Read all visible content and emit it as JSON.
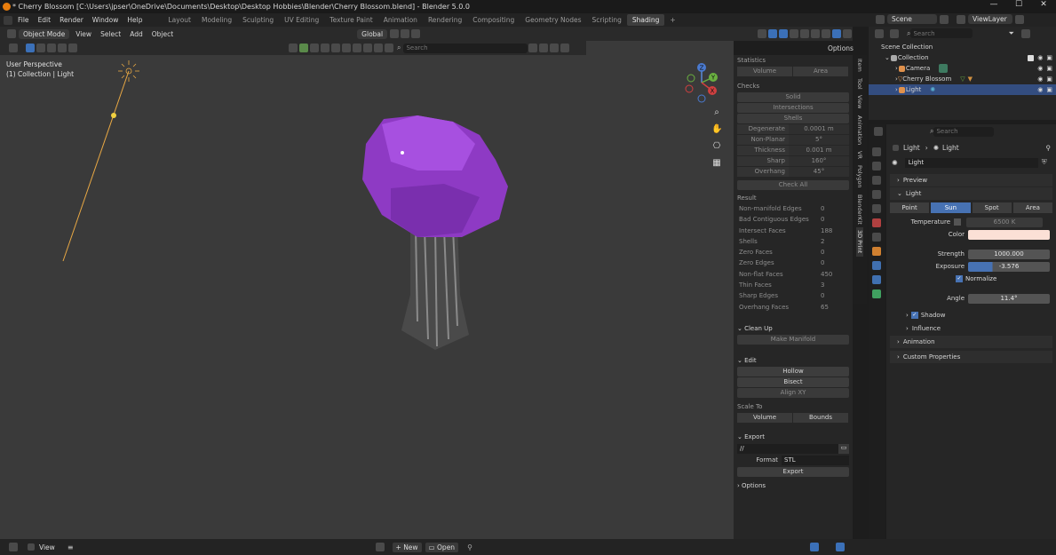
{
  "window": {
    "title": "* Cherry Blossom [C:\\Users\\jpser\\OneDrive\\Documents\\Desktop\\Desktop Hobbies\\Blender\\Cherry Blossom.blend] - Blender 5.0.0"
  },
  "menu": {
    "items": [
      "File",
      "Edit",
      "Render",
      "Window",
      "Help"
    ]
  },
  "workspaces": [
    "Layout",
    "Modeling",
    "Sculpting",
    "UV Editing",
    "Texture Paint",
    "Animation",
    "Rendering",
    "Compositing",
    "Geometry Nodes",
    "Scripting",
    "Shading"
  ],
  "scene": {
    "label": "Scene",
    "viewlayer": "ViewLayer",
    "search_placeholder": "Search"
  },
  "viewport_header": {
    "mode": "Object Mode",
    "view": "View",
    "select": "Select",
    "add": "Add",
    "object": "Object",
    "orientation": "Global",
    "options": "Options",
    "search_placeholder": "Search"
  },
  "viewport": {
    "perspective": "User Perspective",
    "collection": "(1) Collection | Light",
    "colors": {
      "bg": "#3a3a3a",
      "canopy": "#9b3fd0",
      "trunk": "#6a6a6a",
      "light_line": "#e8a844"
    }
  },
  "nav_gizmo": {
    "x": "X",
    "y": "Y",
    "z": "Z"
  },
  "npanel": {
    "statistics": "Statistics",
    "stat_volume": "Volume",
    "stat_area": "Area",
    "checks": "Checks",
    "solid": "Solid",
    "intersections": "Intersections",
    "shells": "Shells",
    "fields": [
      {
        "l": "Degenerate",
        "v": "0.0001 m"
      },
      {
        "l": "Non-Planar",
        "v": "5°"
      },
      {
        "l": "Thickness",
        "v": "0.001 m"
      },
      {
        "l": "Sharp",
        "v": "160°"
      },
      {
        "l": "Overhang",
        "v": "45°"
      }
    ],
    "check_all": "Check All",
    "result": "Result",
    "results": [
      {
        "l": "Non-manifold Edges",
        "v": "0"
      },
      {
        "l": "Bad Contiguous Edges",
        "v": "0"
      },
      {
        "l": "Intersect Faces",
        "v": "188"
      },
      {
        "l": "Shells",
        "v": "2"
      },
      {
        "l": "Zero Faces",
        "v": "0"
      },
      {
        "l": "Zero Edges",
        "v": "0"
      },
      {
        "l": "Non-flat Faces",
        "v": "450"
      },
      {
        "l": "Thin Faces",
        "v": "3"
      },
      {
        "l": "Sharp Edges",
        "v": "0"
      },
      {
        "l": "Overhang Faces",
        "v": "65"
      }
    ],
    "cleanup": "Clean Up",
    "make_manifold": "Make Manifold",
    "edit": "Edit",
    "hollow": "Hollow",
    "bisect": "Bisect",
    "align_xy": "Align XY",
    "scale_to": "Scale To",
    "volume": "Volume",
    "bounds": "Bounds",
    "export": "Export",
    "path": "//",
    "format_label": "Format",
    "format": "STL",
    "export_btn": "Export",
    "options": "Options"
  },
  "vtabs": [
    "Item",
    "Tool",
    "View",
    "Animation",
    "VR",
    "Polygon",
    "BlenderKit",
    "3D Print"
  ],
  "outliner": {
    "root": "Scene Collection",
    "collection": "Collection",
    "items": [
      "Camera",
      "Cherry Blossom",
      "Light"
    ]
  },
  "properties": {
    "search_placeholder": "Search",
    "breadcrumb_a": "Light",
    "breadcrumb_b": "Light",
    "data_name": "Light",
    "preview": "Preview",
    "light": "Light",
    "types": [
      "Point",
      "Sun",
      "Spot",
      "Area"
    ],
    "temperature_label": "Temperature",
    "temperature": "6500 K",
    "color_label": "Color",
    "color": "#fbe0d6",
    "strength_label": "Strength",
    "strength": "1000.000",
    "exposure_label": "Exposure",
    "exposure": "-3.576",
    "normalize": "Normalize",
    "angle_label": "Angle",
    "angle": "11.4°",
    "shadow": "Shadow",
    "influence": "Influence",
    "animation": "Animation",
    "custom_properties": "Custom Properties"
  },
  "statusbar": {
    "view": "View",
    "new": "New",
    "open": "Open"
  }
}
